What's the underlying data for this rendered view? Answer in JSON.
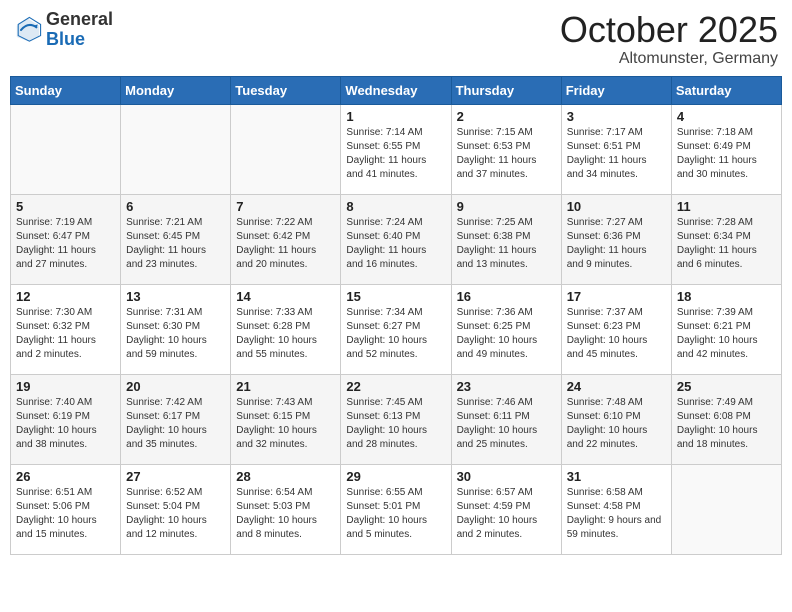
{
  "header": {
    "logo_general": "General",
    "logo_blue": "Blue",
    "month": "October 2025",
    "location": "Altomunster, Germany"
  },
  "days_of_week": [
    "Sunday",
    "Monday",
    "Tuesday",
    "Wednesday",
    "Thursday",
    "Friday",
    "Saturday"
  ],
  "weeks": [
    [
      {
        "day": "",
        "info": ""
      },
      {
        "day": "",
        "info": ""
      },
      {
        "day": "",
        "info": ""
      },
      {
        "day": "1",
        "info": "Sunrise: 7:14 AM\nSunset: 6:55 PM\nDaylight: 11 hours and 41 minutes."
      },
      {
        "day": "2",
        "info": "Sunrise: 7:15 AM\nSunset: 6:53 PM\nDaylight: 11 hours and 37 minutes."
      },
      {
        "day": "3",
        "info": "Sunrise: 7:17 AM\nSunset: 6:51 PM\nDaylight: 11 hours and 34 minutes."
      },
      {
        "day": "4",
        "info": "Sunrise: 7:18 AM\nSunset: 6:49 PM\nDaylight: 11 hours and 30 minutes."
      }
    ],
    [
      {
        "day": "5",
        "info": "Sunrise: 7:19 AM\nSunset: 6:47 PM\nDaylight: 11 hours and 27 minutes."
      },
      {
        "day": "6",
        "info": "Sunrise: 7:21 AM\nSunset: 6:45 PM\nDaylight: 11 hours and 23 minutes."
      },
      {
        "day": "7",
        "info": "Sunrise: 7:22 AM\nSunset: 6:42 PM\nDaylight: 11 hours and 20 minutes."
      },
      {
        "day": "8",
        "info": "Sunrise: 7:24 AM\nSunset: 6:40 PM\nDaylight: 11 hours and 16 minutes."
      },
      {
        "day": "9",
        "info": "Sunrise: 7:25 AM\nSunset: 6:38 PM\nDaylight: 11 hours and 13 minutes."
      },
      {
        "day": "10",
        "info": "Sunrise: 7:27 AM\nSunset: 6:36 PM\nDaylight: 11 hours and 9 minutes."
      },
      {
        "day": "11",
        "info": "Sunrise: 7:28 AM\nSunset: 6:34 PM\nDaylight: 11 hours and 6 minutes."
      }
    ],
    [
      {
        "day": "12",
        "info": "Sunrise: 7:30 AM\nSunset: 6:32 PM\nDaylight: 11 hours and 2 minutes."
      },
      {
        "day": "13",
        "info": "Sunrise: 7:31 AM\nSunset: 6:30 PM\nDaylight: 10 hours and 59 minutes."
      },
      {
        "day": "14",
        "info": "Sunrise: 7:33 AM\nSunset: 6:28 PM\nDaylight: 10 hours and 55 minutes."
      },
      {
        "day": "15",
        "info": "Sunrise: 7:34 AM\nSunset: 6:27 PM\nDaylight: 10 hours and 52 minutes."
      },
      {
        "day": "16",
        "info": "Sunrise: 7:36 AM\nSunset: 6:25 PM\nDaylight: 10 hours and 49 minutes."
      },
      {
        "day": "17",
        "info": "Sunrise: 7:37 AM\nSunset: 6:23 PM\nDaylight: 10 hours and 45 minutes."
      },
      {
        "day": "18",
        "info": "Sunrise: 7:39 AM\nSunset: 6:21 PM\nDaylight: 10 hours and 42 minutes."
      }
    ],
    [
      {
        "day": "19",
        "info": "Sunrise: 7:40 AM\nSunset: 6:19 PM\nDaylight: 10 hours and 38 minutes."
      },
      {
        "day": "20",
        "info": "Sunrise: 7:42 AM\nSunset: 6:17 PM\nDaylight: 10 hours and 35 minutes."
      },
      {
        "day": "21",
        "info": "Sunrise: 7:43 AM\nSunset: 6:15 PM\nDaylight: 10 hours and 32 minutes."
      },
      {
        "day": "22",
        "info": "Sunrise: 7:45 AM\nSunset: 6:13 PM\nDaylight: 10 hours and 28 minutes."
      },
      {
        "day": "23",
        "info": "Sunrise: 7:46 AM\nSunset: 6:11 PM\nDaylight: 10 hours and 25 minutes."
      },
      {
        "day": "24",
        "info": "Sunrise: 7:48 AM\nSunset: 6:10 PM\nDaylight: 10 hours and 22 minutes."
      },
      {
        "day": "25",
        "info": "Sunrise: 7:49 AM\nSunset: 6:08 PM\nDaylight: 10 hours and 18 minutes."
      }
    ],
    [
      {
        "day": "26",
        "info": "Sunrise: 6:51 AM\nSunset: 5:06 PM\nDaylight: 10 hours and 15 minutes."
      },
      {
        "day": "27",
        "info": "Sunrise: 6:52 AM\nSunset: 5:04 PM\nDaylight: 10 hours and 12 minutes."
      },
      {
        "day": "28",
        "info": "Sunrise: 6:54 AM\nSunset: 5:03 PM\nDaylight: 10 hours and 8 minutes."
      },
      {
        "day": "29",
        "info": "Sunrise: 6:55 AM\nSunset: 5:01 PM\nDaylight: 10 hours and 5 minutes."
      },
      {
        "day": "30",
        "info": "Sunrise: 6:57 AM\nSunset: 4:59 PM\nDaylight: 10 hours and 2 minutes."
      },
      {
        "day": "31",
        "info": "Sunrise: 6:58 AM\nSunset: 4:58 PM\nDaylight: 9 hours and 59 minutes."
      },
      {
        "day": "",
        "info": ""
      }
    ]
  ]
}
